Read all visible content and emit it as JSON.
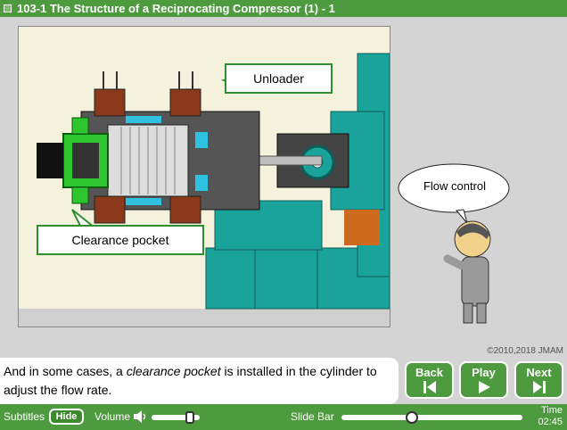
{
  "header": {
    "title": "103-1  The Structure of a Reciprocating Compressor (1) - 1"
  },
  "diagram": {
    "callouts": {
      "unloader": "Unloader",
      "clearance_pocket": "Clearance pocket"
    }
  },
  "presenter": {
    "speech": "Flow control"
  },
  "copyright": "©2010,2018 JMAM",
  "subtitle": {
    "before": "And in some cases, a ",
    "emphasis": "clearance pocket",
    "after": " is installed in the cylinder to adjust the flow rate."
  },
  "nav": {
    "back": "Back",
    "play": "Play",
    "next": "Next"
  },
  "controls": {
    "subtitles_label": "Subtitles",
    "hide_button": "Hide",
    "volume_label": "Volume",
    "volume_level": 0.8,
    "slide_bar_label": "Slide Bar",
    "slide_progress": 0.39,
    "time_label": "Time",
    "time_value": "02:45"
  },
  "colors": {
    "brand_green": "#4e9a3e",
    "machine_teal": "#1aa39a",
    "highlight_green": "#2ec52e"
  }
}
